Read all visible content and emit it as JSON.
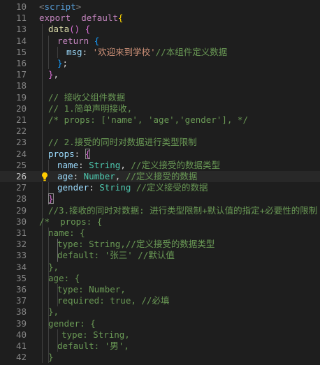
{
  "editor": {
    "lines": [
      {
        "n": "10",
        "tokens": [
          [
            "tag",
            "<"
          ],
          [
            "tn",
            "script"
          ],
          [
            "tag",
            ">"
          ]
        ]
      },
      {
        "n": "11",
        "tokens": [
          [
            "kw",
            "export"
          ],
          [
            "",
            "  "
          ],
          [
            "kw",
            "default"
          ],
          [
            "b1",
            "{"
          ]
        ]
      },
      {
        "n": "13",
        "tokens": [
          [
            "",
            ""
          ],
          [
            "f",
            "data"
          ],
          [
            "b2",
            "()"
          ],
          [
            "",
            " "
          ],
          [
            "b2",
            "{"
          ]
        ]
      },
      {
        "n": "14",
        "tokens": [
          [
            "kw",
            "return"
          ],
          [
            "",
            " "
          ],
          [
            "b3",
            "{"
          ]
        ]
      },
      {
        "n": "15",
        "tokens": [
          [
            "p",
            "msg"
          ],
          [
            "",
            ": "
          ],
          [
            "s",
            "'欢迎来到学校'"
          ],
          [
            "c",
            "//本组件定义数据"
          ]
        ]
      },
      {
        "n": "16",
        "tokens": [
          [
            "b3",
            "}"
          ],
          [
            "",
            ";"
          ]
        ]
      },
      {
        "n": "17",
        "tokens": [
          [
            "b2",
            "}"
          ],
          [
            "",
            ","
          ]
        ]
      },
      {
        "n": "18",
        "tokens": []
      },
      {
        "n": "19",
        "tokens": [
          [
            "c",
            "// 接收父组件数据"
          ]
        ]
      },
      {
        "n": "20",
        "tokens": [
          [
            "c",
            "// 1.简单声明接收,"
          ]
        ]
      },
      {
        "n": "21",
        "tokens": [
          [
            "c",
            "/* props: ['name', 'age','gender'], */"
          ]
        ]
      },
      {
        "n": "22",
        "tokens": []
      },
      {
        "n": "23",
        "tokens": [
          [
            "c",
            "// 2.接受的同时对数据进行类型限制"
          ]
        ]
      },
      {
        "n": "24",
        "tokens": [
          [
            "p",
            "props"
          ],
          [
            "",
            ": "
          ],
          [
            "b2",
            "{"
          ]
        ]
      },
      {
        "n": "25",
        "tokens": [
          [
            "p",
            "name"
          ],
          [
            "",
            ": "
          ],
          [
            "t",
            "String"
          ],
          [
            "",
            ", "
          ],
          [
            "c",
            "//定义接受的数据类型"
          ]
        ]
      },
      {
        "n": "26",
        "tokens": [
          [
            "p",
            "age"
          ],
          [
            "",
            ": "
          ],
          [
            "t",
            "Number"
          ],
          [
            "",
            ", "
          ],
          [
            "c",
            "//定义接受的数据"
          ]
        ]
      },
      {
        "n": "27",
        "tokens": [
          [
            "p",
            "gender"
          ],
          [
            "",
            ": "
          ],
          [
            "t",
            "String"
          ],
          [
            "",
            " "
          ],
          [
            "c",
            "//定义接受的数据"
          ]
        ]
      },
      {
        "n": "28",
        "tokens": [
          [
            "b2",
            "}"
          ]
        ]
      },
      {
        "n": "29",
        "tokens": [
          [
            "c",
            "//3.接收的同时对数据: 进行类型限制+默认值的指定+必要性的限制"
          ]
        ]
      },
      {
        "n": "30",
        "tokens": [
          [
            "c",
            "/*  props: {"
          ]
        ]
      },
      {
        "n": "31",
        "tokens": [
          [
            "c",
            "name: {"
          ]
        ]
      },
      {
        "n": "32",
        "tokens": [
          [
            "c",
            "type: String,//定义接受的数据类型"
          ]
        ]
      },
      {
        "n": "33",
        "tokens": [
          [
            "c",
            "default: '张三' //默认值"
          ]
        ]
      },
      {
        "n": "34",
        "tokens": [
          [
            "c",
            "},"
          ]
        ]
      },
      {
        "n": "35",
        "tokens": [
          [
            "c",
            "age: {"
          ]
        ]
      },
      {
        "n": "36",
        "tokens": [
          [
            "c",
            "type: Number,"
          ]
        ]
      },
      {
        "n": "37",
        "tokens": [
          [
            "c",
            "required: true, //必填"
          ]
        ]
      },
      {
        "n": "38",
        "tokens": [
          [
            "c",
            "},"
          ]
        ]
      },
      {
        "n": "39",
        "tokens": [
          [
            "c",
            "gender: {"
          ]
        ]
      },
      {
        "n": "40",
        "tokens": [
          [
            "c",
            "type: String,"
          ]
        ]
      },
      {
        "n": "41",
        "tokens": [
          [
            "c",
            "default: '男',"
          ]
        ]
      },
      {
        "n": "42",
        "tokens": [
          [
            "c",
            "}"
          ]
        ]
      }
    ],
    "active_line": "26",
    "lightbulb_icon": "lightbulb-icon"
  }
}
